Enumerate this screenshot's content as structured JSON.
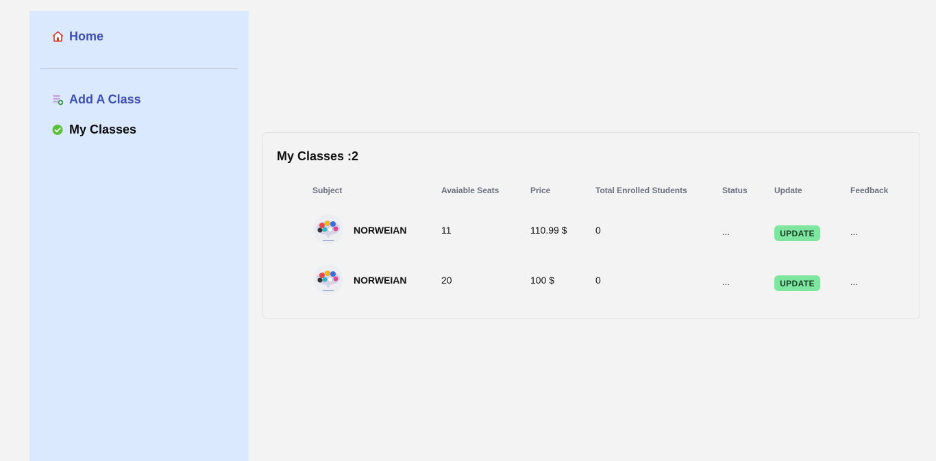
{
  "sidebar": {
    "home_label": "Home",
    "add_class_label": "Add A Class",
    "my_classes_label": "My Classes"
  },
  "main": {
    "title": "My Classes :2",
    "headers": {
      "subject": "Subject",
      "seats": "Avaiable Seats",
      "price": "Price",
      "enrolled": "Total Enrolled Students",
      "status": "Status",
      "update": "Update",
      "feedback": "Feedback"
    },
    "rows": [
      {
        "subject": "NORWEIAN",
        "seats": "11",
        "price": "110.99 $",
        "enrolled": "0",
        "status": "...",
        "update": "UPDATE",
        "feedback": "..."
      },
      {
        "subject": "NORWEIAN",
        "seats": "20",
        "price": "100 $",
        "enrolled": "0",
        "status": "...",
        "update": "UPDATE",
        "feedback": "..."
      }
    ]
  },
  "icons": {
    "home": "home-icon",
    "add_class": "add-class-icon",
    "my_classes": "check-circle-icon",
    "subject_image": "subject-thumbnail"
  },
  "colors": {
    "sidebar_bg": "#dbe9fe",
    "nav_link": "#3f4fb0",
    "update_button": "#7fe6a0",
    "page_bg": "#f3f3f3"
  }
}
